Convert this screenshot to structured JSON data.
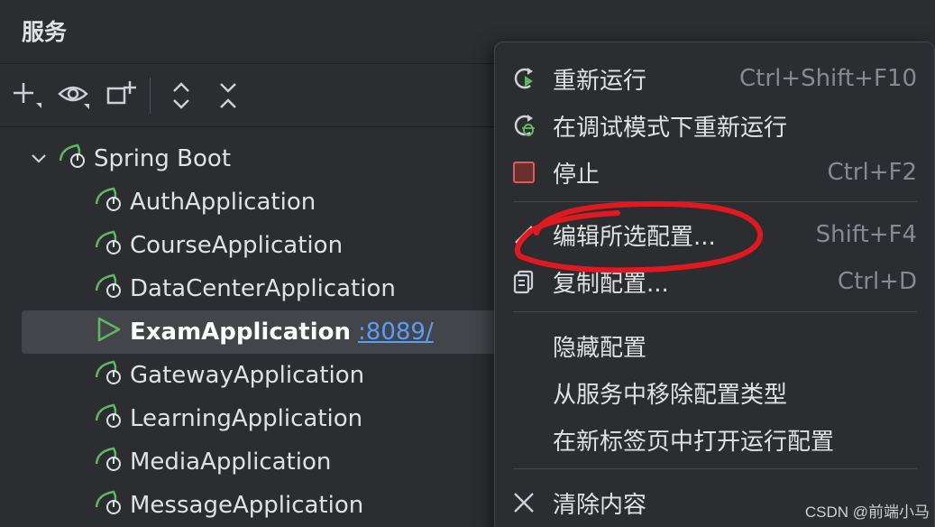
{
  "panel": {
    "title": "服务"
  },
  "toolbar": {
    "icons": [
      "add-icon",
      "eye-icon",
      "new-group-icon",
      "expand-all-icon",
      "collapse-all-icon"
    ]
  },
  "tree": {
    "root": {
      "label": "Spring Boot",
      "icon": "spring-boot-icon",
      "expanded": true
    },
    "items": [
      {
        "label": "AuthApplication",
        "icon": "spring-boot-icon"
      },
      {
        "label": "CourseApplication",
        "icon": "spring-boot-icon"
      },
      {
        "label": "DataCenterApplication",
        "icon": "spring-boot-icon"
      },
      {
        "label": "ExamApplication",
        "icon": "run-icon",
        "port": ":8089/",
        "selected": true
      },
      {
        "label": "GatewayApplication",
        "icon": "spring-boot-icon"
      },
      {
        "label": "LearningApplication",
        "icon": "spring-boot-icon"
      },
      {
        "label": "MediaApplication",
        "icon": "spring-boot-icon"
      },
      {
        "label": "MessageApplication",
        "icon": "spring-boot-icon"
      }
    ]
  },
  "context_menu": {
    "items": [
      {
        "label": "重新运行",
        "shortcut": "Ctrl+Shift+F10",
        "icon": "rerun-icon"
      },
      {
        "label": "在调试模式下重新运行",
        "shortcut": "",
        "icon": "rerun-debug-icon"
      },
      {
        "label": "停止",
        "shortcut": "Ctrl+F2",
        "icon": "stop-icon"
      },
      {
        "label": "编辑所选配置...",
        "shortcut": "Shift+F4",
        "icon": "edit-icon"
      },
      {
        "label": "复制配置...",
        "shortcut": "Ctrl+D",
        "icon": "copy-icon"
      },
      {
        "label": "隐藏配置",
        "shortcut": "",
        "icon": ""
      },
      {
        "label": "从服务中移除配置类型",
        "shortcut": "",
        "icon": ""
      },
      {
        "label": "在新标签页中打开运行配置",
        "shortcut": "",
        "icon": ""
      },
      {
        "label": "清除内容",
        "shortcut": "",
        "icon": "close-icon"
      }
    ]
  },
  "colors": {
    "background": "#2b2d30",
    "selected_row": "#43454a",
    "link": "#589df6",
    "spring_green": "#5fb85f",
    "run_green": "#5fb85f",
    "annotation_red": "#e0181f"
  },
  "watermark": "CSDN @前端小马"
}
